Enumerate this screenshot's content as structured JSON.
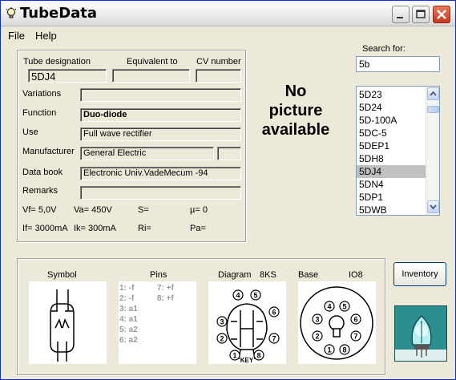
{
  "window": {
    "title": "TubeData"
  },
  "menu": {
    "file": "File",
    "help": "Help"
  },
  "fields": {
    "tube_designation_label": "Tube designation",
    "equivalent_label": "Equivalent to",
    "cv_label": "CV number",
    "tube_designation": "5DJ4",
    "equivalent": "",
    "cv_number": "",
    "variations_label": "Variations",
    "variations": "",
    "function_label": "Function",
    "function": "Duo-diode",
    "use_label": "Use",
    "use": "Full wave rectifier",
    "manufacturer_label": "Manufacturer",
    "manufacturer": "General Electric",
    "manufacturer_extra": "",
    "databook_label": "Data book",
    "databook": "Electronic Univ.VadeMecum -94",
    "remarks_label": "Remarks",
    "remarks": ""
  },
  "params": {
    "vf": "Vf= 5,0V",
    "va": "Va=  450V",
    "s": "S=",
    "mu": "µ=    0",
    "if": "If= 3000mA",
    "ik": "Ik=   300mA",
    "ri": "Ri=",
    "pa": "Pa="
  },
  "no_picture": {
    "line1": "No",
    "line2": "picture",
    "line3": "available"
  },
  "search": {
    "label": "Search for:",
    "value": "5b"
  },
  "tube_list": {
    "items": [
      "5D23",
      "5D24",
      "5D-100A",
      "5DC-5",
      "5DEP1",
      "5DH8",
      "5DJ4",
      "5DN4",
      "5DP1",
      "5DWB"
    ],
    "selected_index": 6
  },
  "bottom": {
    "symbol_label": "Symbol",
    "pins_label": "Pins",
    "diagram_label": "Diagram",
    "diagram_code": "8KS",
    "base_label": "Base",
    "base_code": "IO8",
    "pins_col1": [
      "1: -f",
      "2: -f",
      "3: a1",
      "4: a1",
      "5: a2",
      "6: a2"
    ],
    "pins_col2": [
      "7: +f",
      "8: +f"
    ],
    "diagram_pin_numbers": [
      "1",
      "2",
      "3",
      "4",
      "5",
      "6",
      "7",
      "8"
    ],
    "key_label": "KEY",
    "base_pin_numbers": [
      "1",
      "2",
      "3",
      "4",
      "5",
      "6",
      "7",
      "8"
    ]
  },
  "buttons": {
    "inventory": "Inventory"
  },
  "icons": {
    "app": "lightbulb-icon",
    "minimize": "minimize-icon",
    "maximize": "maximize-icon",
    "close": "close-icon",
    "logo": "tube-logo-icon"
  },
  "colors": {
    "window_border": "#0831d9",
    "close_button": "#c4381b",
    "selection": "#c0c0c0",
    "logo": "#2c8e8e"
  }
}
